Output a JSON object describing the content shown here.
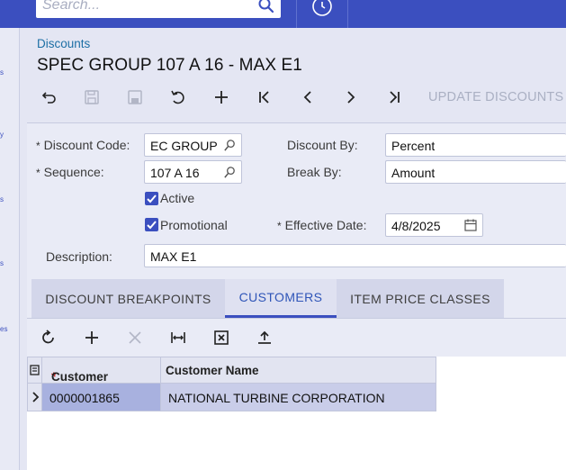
{
  "topbar": {
    "search_placeholder": "Search..."
  },
  "leftnav": {
    "fragments": [
      "s",
      "y",
      "s",
      "s",
      "s",
      "es"
    ]
  },
  "page": {
    "breadcrumb": "Discounts",
    "title": "SPEC GROUP 107 A 16 - MAX E1"
  },
  "toolbar": {
    "update_discounts_label": "UPDATE DISCOUNTS"
  },
  "form": {
    "discount_code_label": "Discount Code:",
    "discount_code_value": "EC GROUP",
    "sequence_label": "Sequence:",
    "sequence_value": "107 A 16",
    "active_label": "Active",
    "active_checked": true,
    "promotional_label": "Promotional",
    "promotional_checked": true,
    "description_label": "Description:",
    "description_value": "MAX E1",
    "discount_by_label": "Discount By:",
    "discount_by_value": "Percent",
    "break_by_label": "Break By:",
    "break_by_value": "Amount",
    "effective_date_label": "Effective Date:",
    "effective_date_value": "4/8/2025",
    "required_marker": "*"
  },
  "tabs": [
    {
      "label": "DISCOUNT BREAKPOINTS",
      "active": false
    },
    {
      "label": "CUSTOMERS",
      "active": true
    },
    {
      "label": "ITEM PRICE CLASSES",
      "active": false
    }
  ],
  "grid": {
    "columns": [
      "Customer",
      "Customer Name"
    ],
    "required_marker": "*",
    "rows": [
      {
        "customer": "0000001865",
        "customer_name": "NATIONAL TURBINE CORPORATION"
      }
    ]
  },
  "colors": {
    "accent": "#3b4fbf",
    "link": "#1d6fa5",
    "selected_row": "#c9cde9",
    "selected_cell": "#a8b1df"
  }
}
